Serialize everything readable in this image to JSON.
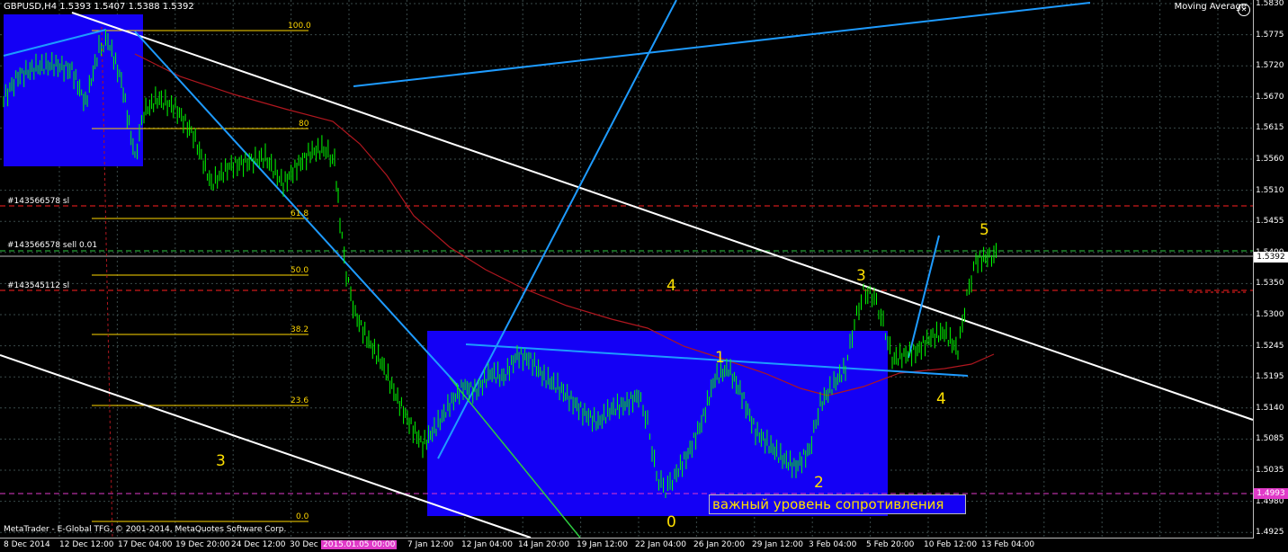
{
  "header": {
    "symbol_label": "GBPUSD,H4  1.5393 1.5407 1.5388 1.5392",
    "indicator_label": "Moving Average"
  },
  "order_lines": {
    "sl_1": "#143566578 sl",
    "sell": "#143566578 sell 0.01",
    "sl_2": "#143545112 sl"
  },
  "fib_levels": [
    "100.0",
    "80",
    "61.8",
    "50.0",
    "38.2",
    "23.6",
    "0.0"
  ],
  "wave_labels": {
    "w3_left": "3",
    "w4_mid": "4",
    "w1": "1",
    "w0": "0",
    "w2": "2",
    "w3_right": "3",
    "w4_right": "4",
    "w5": "5"
  },
  "annotation": "важный уровень сопротивления",
  "footer": "MetaTrader - E-Global TFG, © 2001-2014, MetaQuotes Software Corp.",
  "y_axis": [
    "1.5830",
    "1.5775",
    "1.5720",
    "1.5670",
    "1.5615",
    "1.5560",
    "1.5510",
    "1.5455",
    "1.5400",
    "1.5350",
    "1.5300",
    "1.5245",
    "1.5195",
    "1.5140",
    "1.5085",
    "1.5035",
    "1.4980",
    "1.4925"
  ],
  "price_boxes": {
    "current": "1.5392",
    "level": "1.4993"
  },
  "x_axis": [
    "8 Dec 2014",
    "12 Dec 12:00",
    "17 Dec 04:00",
    "19 Dec 20:00",
    "24 Dec 12:00",
    "30 Dec",
    "2015.01.05 00:00",
    "7 Jan 12:00",
    "12 Jan 04:00",
    "14 Jan 20:00",
    "19 Jan 12:00",
    "22 Jan 04:00",
    "26 Jan 20:00",
    "29 Jan 12:00",
    "3 Feb 04:00",
    "5 Feb 20:00",
    "10 Feb 12:00",
    "13 Feb 04:00"
  ],
  "colors": {
    "background": "#000000",
    "grid": "#3a4a4a",
    "candle": "#00ff00",
    "box": "#1400f5",
    "trendline": "#1e9bff",
    "channel": "#ffffff",
    "moving_average": "#b0171f",
    "fib": "#ffd700",
    "sl_line": "#ff2020",
    "entry_line": "#2ecc40",
    "level_line": "#e03ac8"
  }
}
